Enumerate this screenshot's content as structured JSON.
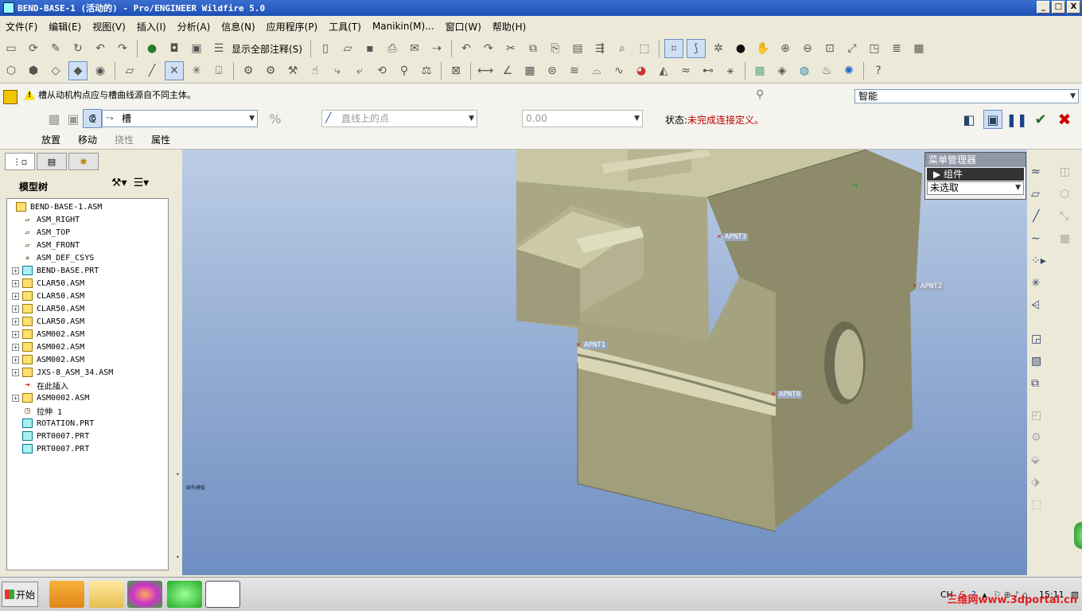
{
  "window": {
    "title": "BEND-BASE-1 (活动的) - Pro/ENGINEER Wildfire 5.0",
    "buttons": [
      "_",
      "□",
      "X"
    ]
  },
  "menubar": {
    "items": [
      "文件(F)",
      "编辑(E)",
      "视图(V)",
      "插入(I)",
      "分析(A)",
      "信息(N)",
      "应用程序(P)",
      "工具(T)",
      "Manikin(M)...",
      "窗口(W)",
      "帮助(H)"
    ]
  },
  "toolbar": {
    "show_all_annotations": "显示全部注释(S)"
  },
  "dashboard": {
    "message": "槽从动机构点应与槽曲线源自不同主体。",
    "selection_filter": "智能",
    "connection_type": "槽",
    "reference_placeholder": "直线上的点",
    "offset_value": "0.00",
    "status_label": "状态:",
    "status_value": "未完成连接定义。",
    "tabs": {
      "placement": "放置",
      "move": "移动",
      "flexibility": "挠性",
      "properties": "属性"
    }
  },
  "model_tree": {
    "title": "模型树",
    "items": [
      {
        "label": "BEND-BASE-1.ASM",
        "icon": "assembly-icon",
        "expandable": false,
        "root": true
      },
      {
        "label": "ASM_RIGHT",
        "icon": "datum-plane-icon",
        "expandable": false
      },
      {
        "label": "ASM_TOP",
        "icon": "datum-plane-icon",
        "expandable": false
      },
      {
        "label": "ASM_FRONT",
        "icon": "datum-plane-icon",
        "expandable": false
      },
      {
        "label": "ASM_DEF_CSYS",
        "icon": "coordinate-system-icon",
        "expandable": false
      },
      {
        "label": "BEND-BASE.PRT",
        "icon": "part-icon",
        "expandable": true
      },
      {
        "label": "CLAR50.ASM",
        "icon": "assembly-icon",
        "expandable": true
      },
      {
        "label": "CLAR50.ASM",
        "icon": "assembly-icon",
        "expandable": true
      },
      {
        "label": "CLAR50.ASM",
        "icon": "assembly-icon",
        "expandable": true
      },
      {
        "label": "CLAR50.ASM",
        "icon": "assembly-icon",
        "expandable": true
      },
      {
        "label": "ASM002.ASM",
        "icon": "assembly-icon",
        "expandable": true
      },
      {
        "label": "ASM002.ASM",
        "icon": "assembly-icon",
        "expandable": true
      },
      {
        "label": "ASM002.ASM",
        "icon": "assembly-icon",
        "expandable": true
      },
      {
        "label": "JXS-8_ASM_34.ASM",
        "icon": "assembly-icon",
        "expandable": true
      },
      {
        "label": "在此插入",
        "icon": "insert-here-arrow-icon",
        "expandable": false
      },
      {
        "label": "ASM0002.ASM",
        "icon": "assembly-icon",
        "expandable": true
      },
      {
        "label": "拉伸 1",
        "icon": "extrude-icon",
        "expandable": false
      },
      {
        "label": "ROTATION.PRT",
        "icon": "part-icon",
        "expandable": false
      },
      {
        "label": "PRT0007.PRT",
        "icon": "part-icon",
        "expandable": false
      },
      {
        "label": "PRT0007.PRT",
        "icon": "part-icon",
        "expandable": false
      }
    ]
  },
  "viewport": {
    "points": [
      {
        "label": "APNT3"
      },
      {
        "label": "APNT2"
      },
      {
        "label": "APNT1"
      },
      {
        "label": "APNT0"
      }
    ],
    "corner_note": "缺失模板"
  },
  "menu_manager": {
    "title": "菜单管理器",
    "item": "组件",
    "combo_value": "未选取"
  },
  "taskbar": {
    "start": "开始",
    "lang": "CH",
    "time": "15:11",
    "watermark": "三维网www.3dportal.cn"
  },
  "colors": {
    "model_face": "#c8c6a0",
    "model_shadow": "#8f8d6a",
    "viewport_top": "#bccde6",
    "viewport_bottom": "#6f8ec2",
    "status_error": "#c00000"
  }
}
